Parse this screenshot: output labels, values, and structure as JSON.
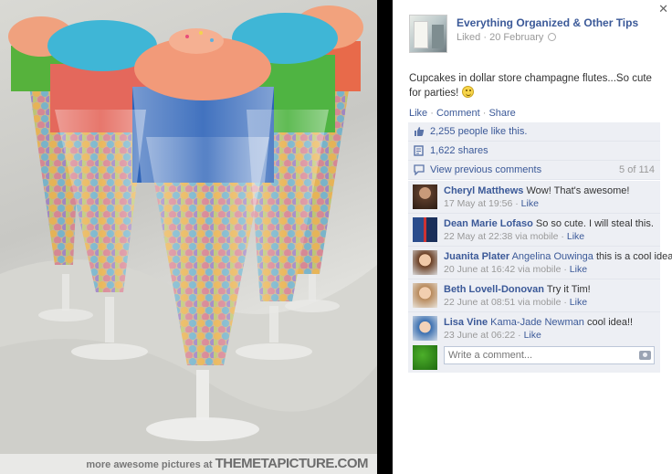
{
  "photo": {
    "watermark_small": "more awesome pictures at",
    "watermark_big": "THEMETAPICTURE.COM"
  },
  "post": {
    "page_name": "Everything Organized & Other Tips",
    "liked_label": "Liked",
    "date": "20 February",
    "caption": "Cupcakes in dollar store champagne flutes...So cute for parties!",
    "actions": {
      "like": "Like",
      "comment": "Comment",
      "share": "Share"
    }
  },
  "ufi": {
    "likes": "2,255 people like this.",
    "shares": "1,622 shares",
    "view_previous": "View previous comments",
    "comment_count": "5 of 114"
  },
  "comments": [
    {
      "author": "Cheryl Matthews",
      "mention": "",
      "text": "Wow! That's awesome!",
      "time": "17 May at 19:56",
      "via": "",
      "like": "Like"
    },
    {
      "author": "Dean Marie Lofaso",
      "mention": "",
      "text": "So so cute. I will steal this.",
      "time": "22 May at 22:38",
      "via": "via mobile",
      "like": "Like"
    },
    {
      "author": "Juanita Plater",
      "mention": "Angelina Ouwinga",
      "text": "this is a cool idea",
      "time": "20 June at 16:42",
      "via": "via mobile",
      "like": "Like"
    },
    {
      "author": "Beth Lovell-Donovan",
      "mention": "",
      "text": "Try it Tim!",
      "time": "22 June at 08:51",
      "via": "via mobile",
      "like": "Like"
    },
    {
      "author": "Lisa Vine",
      "mention": "Kama-Jade Newman",
      "text": "cool idea!!",
      "time": "23 June at 06:22",
      "via": "",
      "like": "Like"
    }
  ],
  "composer": {
    "placeholder": "Write a comment..."
  },
  "colors": {
    "link": "#3b5998",
    "ufi_bg": "#edeff4"
  }
}
